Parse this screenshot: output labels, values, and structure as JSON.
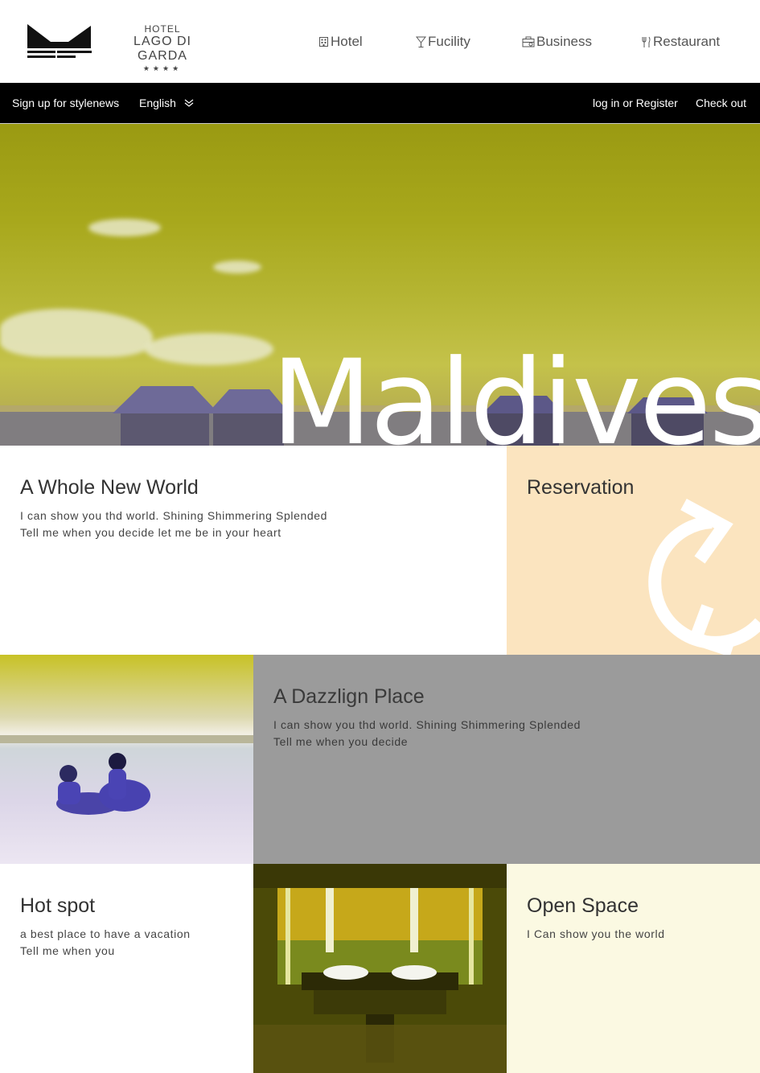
{
  "logo": {
    "hotel": "HOTEL",
    "name": "LAGO DI GARDA",
    "stars": "★★★★"
  },
  "nav": {
    "hotel": "Hotel",
    "facility": "Fucility",
    "business": "Business",
    "restaurant": "Restaurant"
  },
  "topbar": {
    "signup": "Sign up for stylenews",
    "language": "English",
    "login": "log in or Register",
    "checkout": "Check out"
  },
  "hero": {
    "title": "Maldives"
  },
  "panels": {
    "world": {
      "title": "A Whole New World",
      "line1": "I can show you thd world. Shining Shimmering Splended",
      "line2": "Tell me when you decide let me be in your heart"
    },
    "reservation": {
      "title": "Reservation"
    },
    "dazzle": {
      "title": "A Dazzlign Place",
      "line1": "I can show you thd world. Shining Shimmering Splended",
      "line2": "Tell me when you decide"
    },
    "hotspot": {
      "title": "Hot spot",
      "line1": "a best place to have a vacation",
      "line2": "Tell me when you"
    },
    "openspace": {
      "title": "Open Space",
      "line1": "I Can show you the world"
    }
  },
  "icons": {
    "hotel": "building-icon",
    "facility": "cocktail-glass-icon",
    "business": "briefcase-icon",
    "restaurant": "fork-knife-icon",
    "language": "chevron-down-icon",
    "reservation": "refresh-arrow-icon"
  },
  "colors": {
    "topbar": "#000000",
    "reservation_bg": "#fbe4bf",
    "dazzle_bg": "#9b9b9b",
    "openspace_bg": "#fbf9e2"
  }
}
